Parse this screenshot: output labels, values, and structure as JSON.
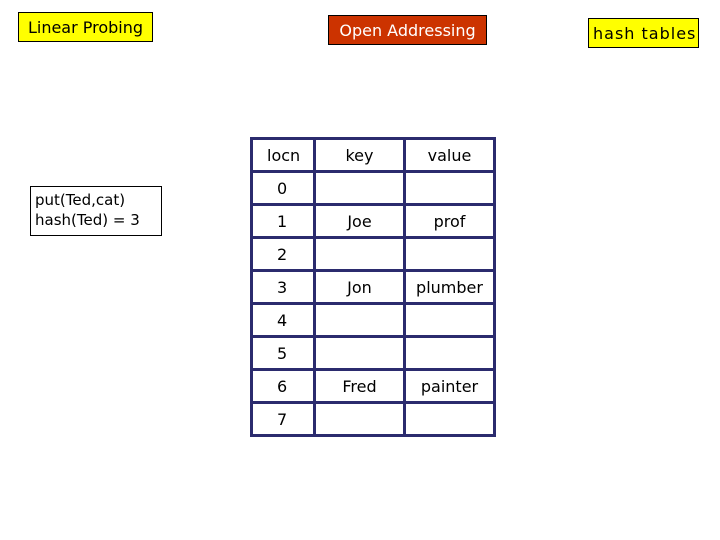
{
  "labels": {
    "linear_probing": "Linear Probing",
    "open_addressing": "Open Addressing",
    "hash_tables": "hash tables"
  },
  "operation": {
    "line1": "put(Ted,cat)",
    "line2": "hash(Ted) = 3"
  },
  "colors": {
    "yellow_label": "#ffff00",
    "orange_label": "#cc3300",
    "table_border": "#2b2b6e"
  },
  "table": {
    "headers": [
      "locn",
      "key",
      "value"
    ],
    "rows": [
      {
        "locn": "0",
        "key": "",
        "value": ""
      },
      {
        "locn": "1",
        "key": "Joe",
        "value": "prof"
      },
      {
        "locn": "2",
        "key": "",
        "value": ""
      },
      {
        "locn": "3",
        "key": "Jon",
        "value": "plumber"
      },
      {
        "locn": "4",
        "key": "",
        "value": ""
      },
      {
        "locn": "5",
        "key": "",
        "value": ""
      },
      {
        "locn": "6",
        "key": "Fred",
        "value": "painter"
      },
      {
        "locn": "7",
        "key": "",
        "value": ""
      }
    ]
  }
}
